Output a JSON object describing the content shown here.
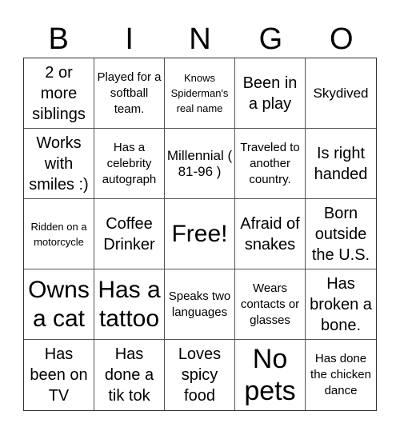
{
  "header": [
    "B",
    "I",
    "N",
    "G",
    "O"
  ],
  "cells": [
    {
      "text": "2 or more siblings",
      "size": "s20"
    },
    {
      "text": "Played for a softball team.",
      "size": "s14"
    },
    {
      "text": "Knows Spiderman's real name",
      "size": "s12"
    },
    {
      "text": "Been in a play",
      "size": "s20"
    },
    {
      "text": "Skydived",
      "size": "s16"
    },
    {
      "text": "Works with smiles :)",
      "size": "s20"
    },
    {
      "text": "Has a celebrity autograph",
      "size": "s14"
    },
    {
      "text": "Millennial ( 81-96 )",
      "size": "s16"
    },
    {
      "text": "Traveled to another country.",
      "size": "s14"
    },
    {
      "text": "Is right handed",
      "size": "s20"
    },
    {
      "text": "Ridden on a motorcycle",
      "size": "s12"
    },
    {
      "text": "Coffee Drinker",
      "size": "s20"
    },
    {
      "text": "Free!",
      "size": "s28"
    },
    {
      "text": "Afraid of snakes",
      "size": "s20"
    },
    {
      "text": "Born outside the U.S.",
      "size": "s20"
    },
    {
      "text": "Owns a cat",
      "size": "s28"
    },
    {
      "text": "Has a tattoo",
      "size": "s28"
    },
    {
      "text": "Speaks two languages",
      "size": "s14"
    },
    {
      "text": "Wears contacts or glasses",
      "size": "s14"
    },
    {
      "text": "Has broken a bone.",
      "size": "s20"
    },
    {
      "text": "Has been on TV",
      "size": "s20"
    },
    {
      "text": "Has done a tik tok",
      "size": "s20"
    },
    {
      "text": "Loves spicy food",
      "size": "s20"
    },
    {
      "text": "No pets",
      "size": "s34"
    },
    {
      "text": "Has done the chicken dance",
      "size": "s14"
    }
  ]
}
